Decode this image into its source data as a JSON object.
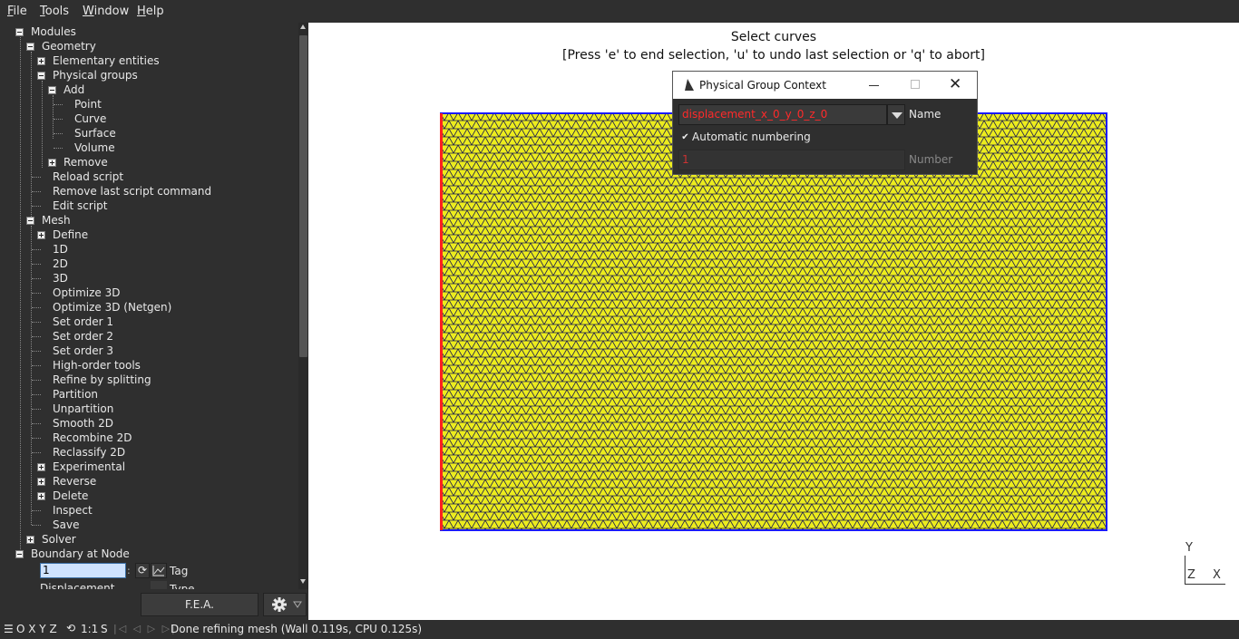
{
  "menu": {
    "items": [
      {
        "first": "F",
        "rest": "ile"
      },
      {
        "first": "T",
        "rest": "ools"
      },
      {
        "first": "W",
        "rest": "indow"
      },
      {
        "first": "H",
        "rest": "elp"
      }
    ]
  },
  "tree": {
    "modules": "Modules",
    "geometry": "Geometry",
    "elementary_entities": "Elementary entities",
    "physical_groups": "Physical groups",
    "add": "Add",
    "point": "Point",
    "curve": "Curve",
    "surface": "Surface",
    "volume": "Volume",
    "remove": "Remove",
    "reload_script": "Reload script",
    "remove_last": "Remove last script command",
    "edit_script": "Edit script",
    "mesh": "Mesh",
    "define": "Define",
    "mesh_items": [
      "1D",
      "2D",
      "3D",
      "Optimize 3D",
      "Optimize 3D (Netgen)",
      "Set order 1",
      "Set order 2",
      "Set order 3",
      "High-order tools",
      "Refine by splitting",
      "Partition",
      "Unpartition",
      "Smooth 2D",
      "Recombine 2D",
      "Reclassify 2D"
    ],
    "experimental": "Experimental",
    "reverse": "Reverse",
    "delete": "Delete",
    "inspect": "Inspect",
    "save": "Save",
    "solver": "Solver",
    "boundary": "Boundary at Node",
    "tag_value": "1",
    "tag_label": "Tag",
    "type_value": "Displacement",
    "type_label": "Type"
  },
  "bottom": {
    "fea_label": "F.E.A."
  },
  "viewport": {
    "prompt_line1": "Select curves",
    "prompt_line2": "[Press 'e' to end selection, 'u' to undo last selection or 'q' to abort]",
    "axis_y": "Y",
    "axis_z": "Z",
    "axis_x": "X",
    "colors": {
      "mesh_fill": "#ecec1e",
      "mesh_lines": "#1c1c50",
      "boundary": "#1a1aff",
      "selected_edge": "#ff2020"
    }
  },
  "dialog": {
    "title": "Physical Group Context",
    "name_value": "displacement_x_0_y_0_z_0",
    "name_label": "Name",
    "auto_numbering": "Automatic numbering",
    "number_value": "1",
    "number_label": "Number"
  },
  "status": {
    "axes": "O X Y Z",
    "scale": "1:1",
    "s": "S",
    "message": "Done refining mesh (Wall 0.119s, CPU 0.125s)"
  }
}
